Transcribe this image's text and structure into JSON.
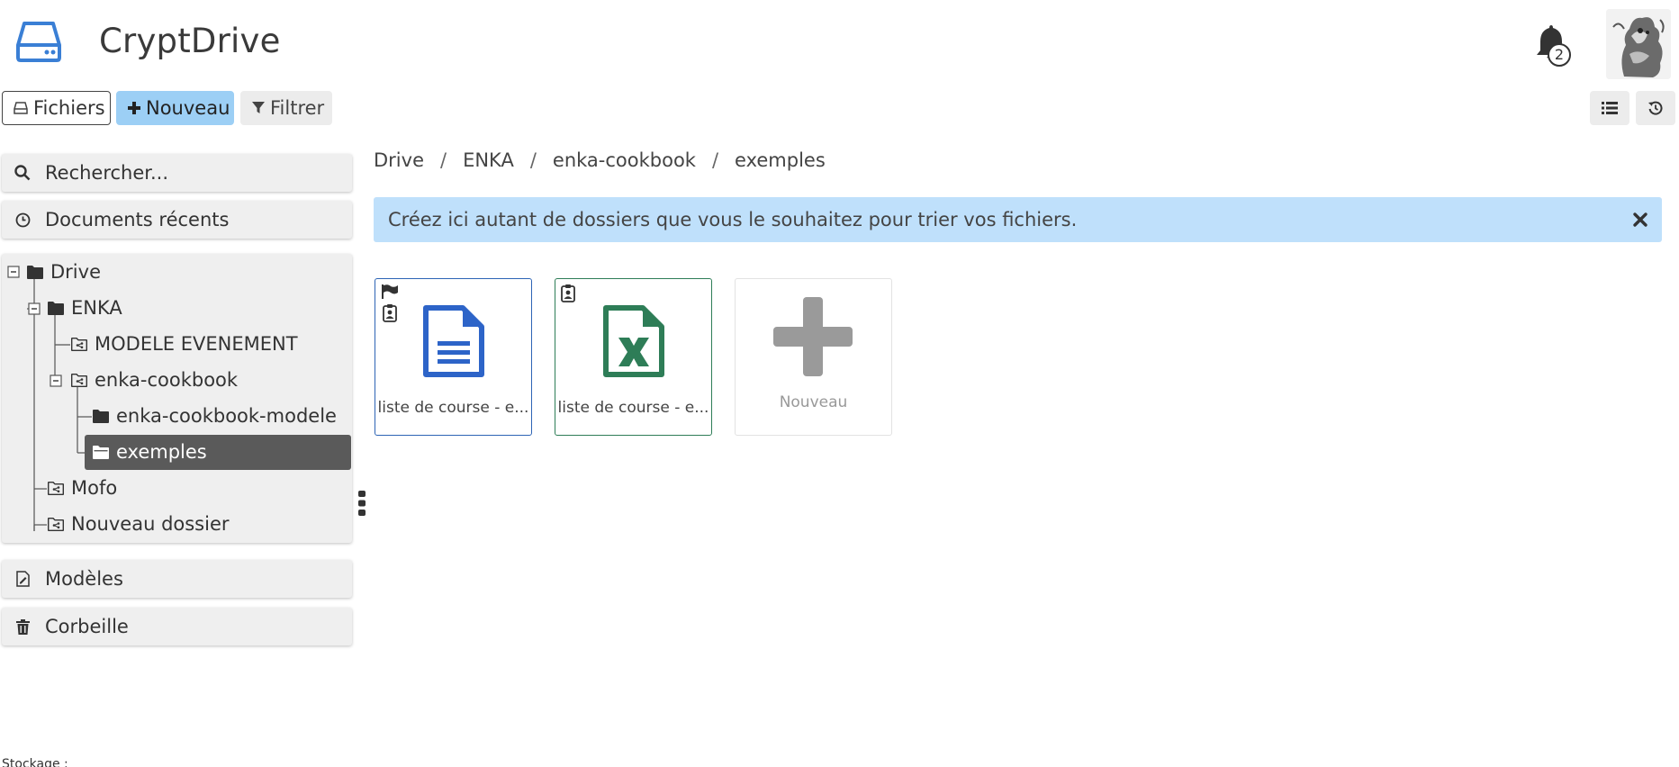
{
  "header": {
    "title": "CryptDrive",
    "notification_count": "2",
    "app_icon": "drive-icon",
    "accent": "#3a7fd5"
  },
  "toolbar": {
    "files_label": "Fichiers",
    "new_label": "Nouveau",
    "filter_label": "Filtrer",
    "new_color": "#9ccff5"
  },
  "sidebar": {
    "search_placeholder": "Rechercher...",
    "recent_label": "Documents récents",
    "models_label": "Modèles",
    "trash_label": "Corbeille",
    "tree": [
      {
        "label": "Drive",
        "icon": "folder-icon"
      },
      {
        "label": "ENKA",
        "icon": "folder-icon"
      },
      {
        "label": "MODELE EVENEMENT",
        "icon": "shared-folder-icon"
      },
      {
        "label": "enka-cookbook",
        "icon": "shared-folder-icon"
      },
      {
        "label": "enka-cookbook-modele",
        "icon": "folder-icon"
      },
      {
        "label": "exemples",
        "icon": "folder-open-icon",
        "selected": true
      },
      {
        "label": "Mofo",
        "icon": "shared-folder-icon"
      },
      {
        "label": "Nouveau dossier",
        "icon": "shared-folder-icon"
      }
    ]
  },
  "breadcrumb": [
    "Drive",
    "ENKA",
    "enka-cookbook",
    "exemples"
  ],
  "info": {
    "message": "Créez ici autant de dossiers que vous le souhaitez pour trier vos fichiers."
  },
  "files": [
    {
      "name": "liste de course - e...",
      "type": "document",
      "color": "#2d64c8",
      "badges": [
        "flag-icon",
        "contact-card-icon"
      ]
    },
    {
      "name": "liste de course - e...",
      "type": "spreadsheet",
      "color": "#2e7d57",
      "badges": [
        "contact-card-icon"
      ]
    }
  ],
  "new_tile": {
    "label": "Nouveau"
  },
  "footer": {
    "storage_label": "Stockage :"
  }
}
